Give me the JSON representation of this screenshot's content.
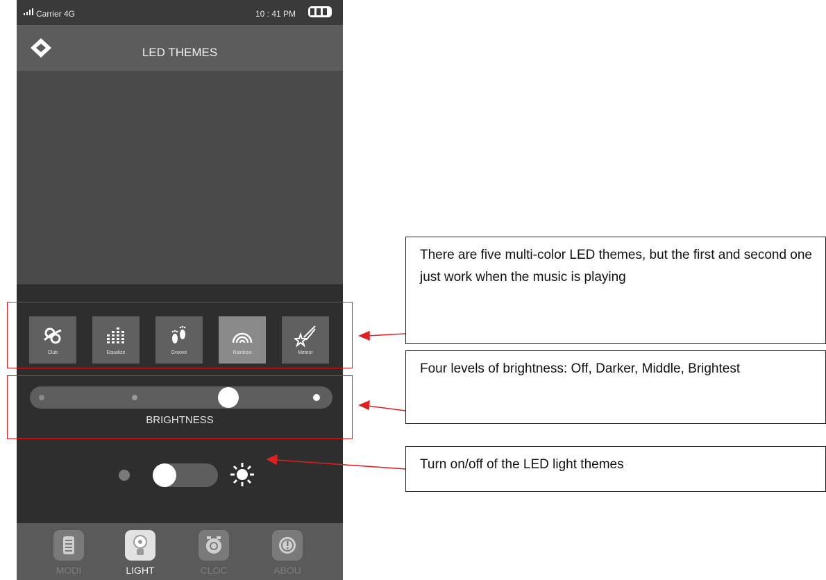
{
  "status_bar": {
    "carrier": "Carrier 4G",
    "time": "10 : 41 PM"
  },
  "header": {
    "title": "LED THEMES",
    "back_icon": "back-arrow-icon"
  },
  "themes": [
    {
      "label": "Club",
      "icon": "club-icon",
      "selected": false
    },
    {
      "label": "Equalize",
      "icon": "equalizer-icon",
      "selected": false
    },
    {
      "label": "Groove",
      "icon": "footprints-icon",
      "selected": false
    },
    {
      "label": "Rainbow",
      "icon": "rainbow-icon",
      "selected": true
    },
    {
      "label": "Meteor",
      "icon": "meteor-icon",
      "selected": false
    }
  ],
  "brightness": {
    "label": "BRIGHTNESS",
    "levels": 4,
    "selected_level": 3
  },
  "power_toggle": {
    "state": "off",
    "icon": "sun-icon"
  },
  "tabs": [
    {
      "label": "MODI",
      "icon": "mode-icon",
      "active": false
    },
    {
      "label": "LIGHT",
      "icon": "bulb-icon",
      "active": true
    },
    {
      "label": "CLOC",
      "icon": "clock-icon",
      "active": false
    },
    {
      "label": "ABOU",
      "icon": "info-icon",
      "active": false
    }
  ],
  "annotations": {
    "themes_note": "There are five multi-color LED themes, but the first and second one just work when the music is playing",
    "brightness_note": "Four levels of brightness: Off, Darker, Middle, Brightest",
    "toggle_note": "Turn on/off of the LED light themes"
  },
  "colors": {
    "annotation_red": "#e02020",
    "panel_dark": "#2e2e2e",
    "active_tile": "#8a8a8a"
  }
}
